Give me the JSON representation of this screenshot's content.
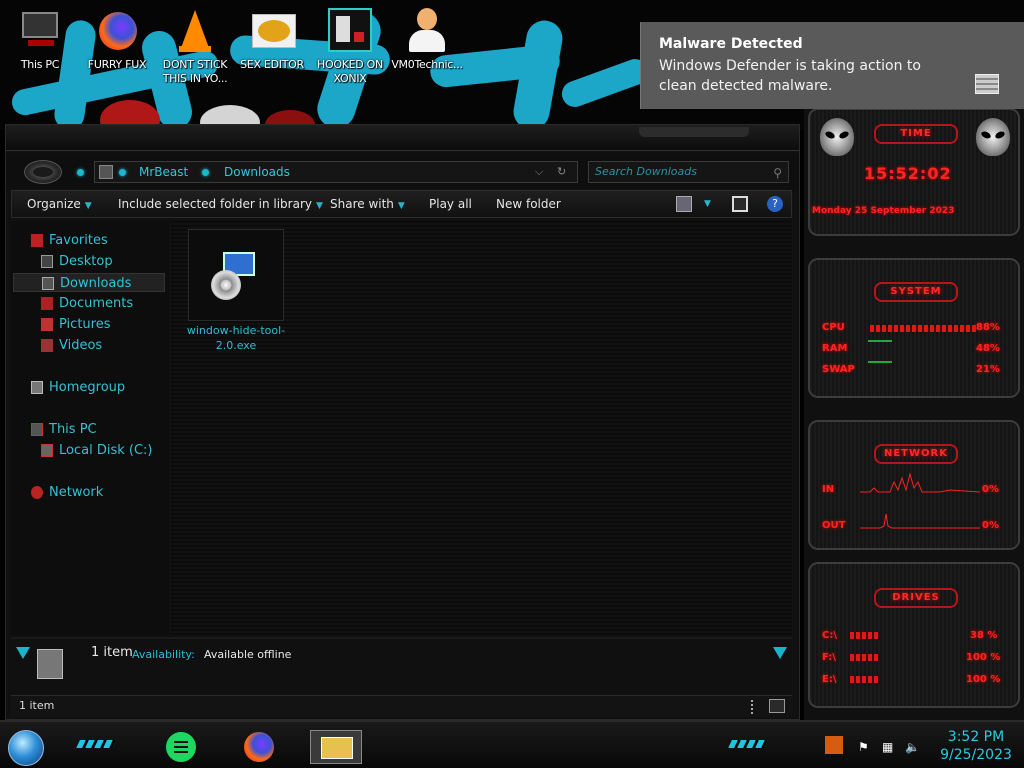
{
  "desktop": {
    "icons": [
      {
        "label": "This PC",
        "icon": "this-pc-icon"
      },
      {
        "label": "FURRY FUX",
        "icon": "firefox-icon"
      },
      {
        "label": "DONT STICK THIS IN YO...",
        "icon": "vlc-icon"
      },
      {
        "label": "SEX EDITOR",
        "icon": "hxd-editor-icon"
      },
      {
        "label": "HOOKED ON XONIX",
        "icon": "xonix-game-icon"
      },
      {
        "label": "VM0Technic...",
        "icon": "doctor-avatar-icon"
      }
    ]
  },
  "toast": {
    "title": "Malware Detected",
    "message": "Windows Defender is taking action to clean detected malware."
  },
  "explorer": {
    "address": {
      "crumbs": [
        "MrBeast",
        "Downloads"
      ]
    },
    "search": {
      "placeholder": "Search Downloads"
    },
    "toolbar": {
      "organize": "Organize",
      "include_library": "Include selected folder in library",
      "share_with": "Share with",
      "play_all": "Play all",
      "new_folder": "New folder"
    },
    "nav": {
      "favorites": "Favorites",
      "desktop": "Desktop",
      "downloads": "Downloads",
      "documents": "Documents",
      "pictures": "Pictures",
      "videos": "Videos",
      "homegroup": "Homegroup",
      "this_pc": "This PC",
      "local_disk": "Local Disk (C:)",
      "network": "Network"
    },
    "file": {
      "name": "window-hide-tool-2.0.exe",
      "icon": "installer-exe-icon"
    },
    "details": {
      "count": "1 item",
      "availability_label": "Availability:",
      "availability_value": "Available offline"
    },
    "status": {
      "count": "1 item"
    }
  },
  "gadgets": {
    "time": {
      "title": "TIME",
      "clock": "15:52:02",
      "date": "Monday 25 September 2023"
    },
    "system": {
      "title": "SYSTEM",
      "rows": [
        {
          "label": "CPU",
          "value": "88%",
          "level": 0.88
        },
        {
          "label": "RAM",
          "value": "48%",
          "level": 0.48
        },
        {
          "label": "SWAP",
          "value": "21%",
          "level": 0.21
        }
      ]
    },
    "network": {
      "title": "NETWORK",
      "in_label": "IN",
      "in_value": "0%",
      "out_label": "OUT",
      "out_value": "0%"
    },
    "drives": {
      "title": "DRIVES",
      "rows": [
        {
          "label": "C:\\",
          "value": "38 %",
          "level": 0.38
        },
        {
          "label": "F:\\",
          "value": "100 %",
          "level": 1.0
        },
        {
          "label": "E:\\",
          "value": "100 %",
          "level": 1.0
        }
      ]
    }
  },
  "taskbar": {
    "clock_time": "3:52 PM",
    "clock_date": "9/25/2023",
    "apps": [
      "notes-app-icon",
      "firefox-icon",
      "file-explorer-icon"
    ]
  },
  "colors": {
    "accent": "#33c1d4",
    "alert": "#ff2424",
    "wallpaper_stroke": "#1ca6c8"
  }
}
